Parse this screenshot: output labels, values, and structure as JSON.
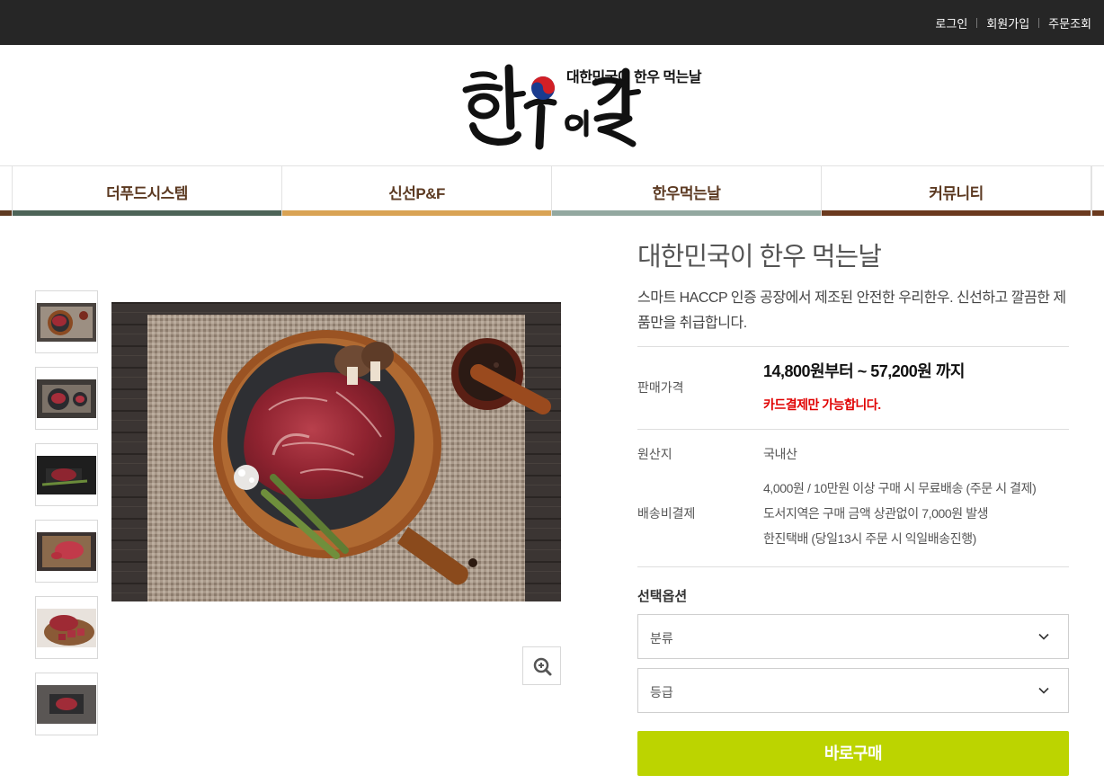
{
  "top_links": [
    "로그인",
    "회원가입",
    "주문조회"
  ],
  "logo": {
    "tagline": "대한민국이 한우 먹는날",
    "brand_text": "한우의날"
  },
  "nav": [
    {
      "label": "더푸드시스템",
      "color": "#4d6458"
    },
    {
      "label": "신선P&F",
      "color": "#d9a354"
    },
    {
      "label": "한우먹는날",
      "color": "#93a8a0"
    },
    {
      "label": "커뮤니티",
      "color": "#6b3a1f"
    }
  ],
  "gallery": {
    "thumbnail_count": 6,
    "zoom_icon": "zoom-in-icon"
  },
  "product": {
    "title": "대한민국이 한우 먹는날",
    "description": "스마트 HACCP 인증 공장에서 제조된 안전한 우리한우. 신선하고 깔끔한 제품만을 취급합니다.",
    "price_label": "판매가격",
    "price": "14,800원부터 ~ 57,200원 까지",
    "payment_note": "카드결제만 가능합니다.",
    "origin_label": "원산지",
    "origin": "국내산",
    "shipping_label": "배송비결제",
    "shipping_lines": [
      "4,000원 / 10만원 이상 구매 시 무료배송 (주문 시 결제)",
      "도서지역은 구매 금액 상관없이 7,000원 발생",
      "한진택배 (당일13시 주문 시 익일배송진행)"
    ]
  },
  "options": {
    "title": "선택옵션",
    "selects": [
      {
        "value": "분류"
      },
      {
        "value": "등급"
      }
    ]
  },
  "buy_button": {
    "label": "바로구매",
    "color": "#bcd400"
  }
}
